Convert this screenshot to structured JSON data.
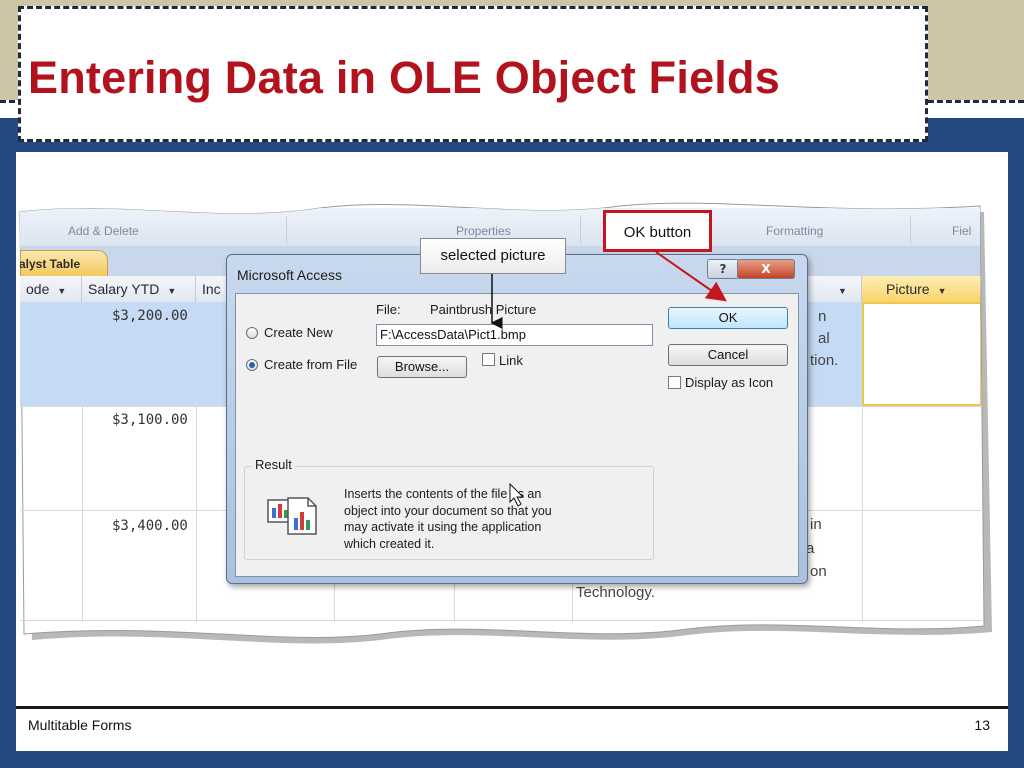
{
  "slide": {
    "title": "Entering Data in OLE Object Fields",
    "footer_left": "Multitable Forms",
    "slide_number": "13"
  },
  "access_window": {
    "ribbon_groups": [
      "Add & Delete",
      "Properties",
      "Formatting",
      "Fiel"
    ],
    "table_tab": "alyst Table",
    "columns": [
      "ode",
      "Salary YTD",
      "Inc",
      "Picture"
    ],
    "rows": [
      {
        "salary": "$3,200.00"
      },
      {
        "salary": "$3,100.00"
      },
      {
        "salary": "$3,400.00"
      }
    ],
    "background_text": [
      "n",
      "al",
      "tion.",
      "in",
      "a",
      "on",
      "Technology."
    ]
  },
  "dialog": {
    "title": "Microsoft Access",
    "help_symbol": "?",
    "close_symbol": "X",
    "file_label": "File:",
    "file_type": "Paintbrush Picture",
    "file_path": "F:\\AccessData\\Pict1.bmp",
    "option_create_new": "Create New",
    "option_create_from_file": "Create from File",
    "selected_option": "Create from File",
    "browse_label": "Browse...",
    "link_label": "Link",
    "link_checked": false,
    "ok_label": "OK",
    "cancel_label": "Cancel",
    "display_as_icon_label": "Display as Icon",
    "display_as_icon_checked": false,
    "result_heading": "Result",
    "result_lines": [
      "Inserts the contents of the file as an",
      "object into your document so that you",
      "may activate it using the application",
      "which created it."
    ]
  },
  "callouts": {
    "selected_picture": "selected picture",
    "ok_button": "OK button"
  },
  "colors": {
    "title_red": "#b1121d",
    "frame_blue": "#244a80",
    "band_tan": "#cdc6a6",
    "callout_border": "#c4161c",
    "selection_blue": "#c5daf4",
    "picture_header": "#f7d46a"
  }
}
